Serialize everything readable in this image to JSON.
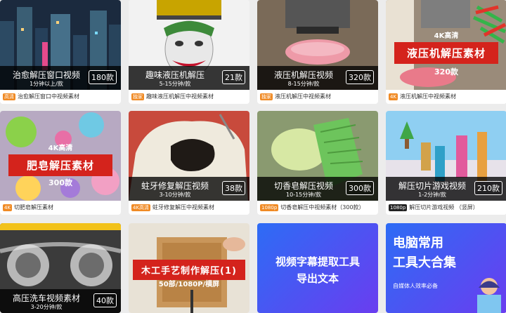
{
  "cards": [
    {
      "title": "治愈解压窗口视频",
      "sub": "1分钟以上/款",
      "count": "180款",
      "badge": "高清",
      "caption": "治愈解压窗口中视频素材"
    },
    {
      "title": "趣味液压机解压",
      "sub": "5-15分钟/款",
      "count": "21款",
      "badge": "独家",
      "caption": "趣味液压机解压中视频素材"
    },
    {
      "title": "液压机解压视频",
      "sub": "8-15分钟/款",
      "count": "320款",
      "badge": "独家",
      "caption": "液压机解压中视频素材"
    },
    {
      "banner": "液压机解压素材",
      "k4": "4K高清",
      "n": "320款",
      "badge": "4K",
      "caption": "液压机解压中视频素材"
    },
    {
      "banner": "肥皂解压素材",
      "k4": "4K高清",
      "n": "300款",
      "badge": "4K",
      "caption": "切肥皂解压素材"
    },
    {
      "title": "蛀牙修复解压视频",
      "sub": "3-10分钟/款",
      "count": "38款",
      "badge": "4K高清",
      "caption": "蛀牙修复解压中视频素材"
    },
    {
      "title": "切香皂解压视频",
      "sub": "10-15分钟/款",
      "count": "300款",
      "badge": "1080p",
      "caption": "切香皂解压中视频素材（300款）"
    },
    {
      "title": "解压切片游戏视频",
      "sub": "1-2分钟/款",
      "count": "210款",
      "badge": "1080p",
      "caption": "解压切片游戏视频  （竖屏）"
    },
    {
      "title": "高压洗车视频素材",
      "sub": "3-20分钟/款",
      "count": "40款"
    },
    {
      "banner": "木工手艺制作解压(1)",
      "sub": "50部/1080P/横屏"
    },
    {
      "line1": "视频字幕提取工具",
      "line2": "导出文本"
    },
    {
      "line1": "电脑常用",
      "line2": "工具大合集",
      "sub": "自媒体人效率必备"
    }
  ],
  "colors": {
    "overlay": "#000000",
    "badge_orange": "#f08a24",
    "banner_red": "#d4231c",
    "blue1": "#2d6cf5",
    "blue2": "#6a3df0"
  }
}
